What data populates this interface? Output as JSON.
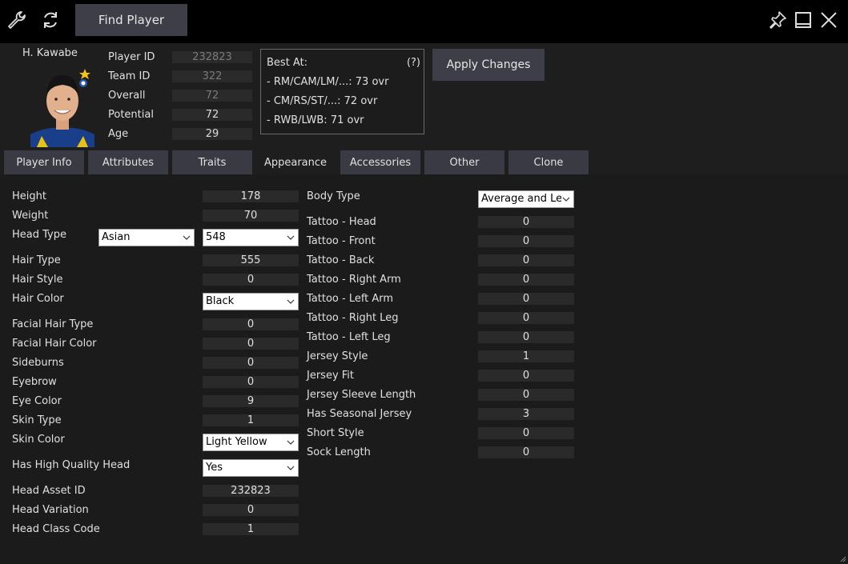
{
  "toolbar": {
    "find_player_label": "Find Player",
    "icons": [
      "wrench-icon",
      "refresh-icon",
      "pin-icon",
      "maximize-icon",
      "close-icon"
    ]
  },
  "player": {
    "name": "H. Kawabe",
    "info": [
      {
        "label": "Player ID",
        "value": "232823"
      },
      {
        "label": "Team ID",
        "value": "322"
      },
      {
        "label": "Overall",
        "value": "72"
      },
      {
        "label": "Potential",
        "value": "72"
      },
      {
        "label": "Age",
        "value": "29"
      }
    ]
  },
  "best_at": {
    "title": "Best At:",
    "help": "(?)",
    "lines": [
      "- RM/CAM/LM/...: 73 ovr",
      "- CM/RS/ST/...: 72 ovr",
      "- RWB/LWB: 71 ovr"
    ]
  },
  "apply_label": "Apply Changes",
  "tabs": [
    "Player Info",
    "Attributes",
    "Traits",
    "Appearance",
    "Accessories",
    "Other",
    "Clone"
  ],
  "active_tab": "Appearance",
  "left_fields": {
    "height": {
      "label": "Height",
      "value": "178"
    },
    "weight": {
      "label": "Weight",
      "value": "70"
    },
    "head_type": {
      "label": "Head Type",
      "select1": "Asian",
      "select2": "548"
    },
    "hair_type": {
      "label": "Hair Type",
      "value": "555"
    },
    "hair_style": {
      "label": "Hair Style",
      "value": "0"
    },
    "hair_color": {
      "label": "Hair Color",
      "select": "Black"
    },
    "facial_hair_type": {
      "label": "Facial Hair Type",
      "value": "0"
    },
    "facial_hair_color": {
      "label": "Facial Hair Color",
      "value": "0"
    },
    "sideburns": {
      "label": "Sideburns",
      "value": "0"
    },
    "eyebrow": {
      "label": "Eyebrow",
      "value": "0"
    },
    "eye_color": {
      "label": "Eye Color",
      "value": "9"
    },
    "skin_type": {
      "label": "Skin Type",
      "value": "1"
    },
    "skin_color": {
      "label": "Skin Color",
      "select": "Light Yellow"
    },
    "hq_head": {
      "label": "Has High Quality Head",
      "select": "Yes"
    },
    "head_asset_id": {
      "label": "Head Asset ID",
      "value": "232823"
    },
    "head_variation": {
      "label": "Head Variation",
      "value": "0"
    },
    "head_class_code": {
      "label": "Head Class Code",
      "value": "1"
    }
  },
  "right_fields": {
    "body_type": {
      "label": "Body Type",
      "select": "Average and Le"
    },
    "tattoo_head": {
      "label": "Tattoo - Head",
      "value": "0"
    },
    "tattoo_front": {
      "label": "Tattoo - Front",
      "value": "0"
    },
    "tattoo_back": {
      "label": "Tattoo - Back",
      "value": "0"
    },
    "tattoo_right_arm": {
      "label": "Tattoo - Right Arm",
      "value": "0"
    },
    "tattoo_left_arm": {
      "label": "Tattoo - Left Arm",
      "value": "0"
    },
    "tattoo_right_leg": {
      "label": "Tattoo - Right Leg",
      "value": "0"
    },
    "tattoo_left_leg": {
      "label": "Tattoo - Left Leg",
      "value": "0"
    },
    "jersey_style": {
      "label": "Jersey Style",
      "value": "1"
    },
    "jersey_fit": {
      "label": "Jersey Fit",
      "value": "0"
    },
    "jersey_sleeve": {
      "label": "Jersey Sleeve Length",
      "value": "0"
    },
    "seasonal_jersey": {
      "label": "Has Seasonal Jersey",
      "value": "3"
    },
    "short_style": {
      "label": "Short Style",
      "value": "0"
    },
    "sock_length": {
      "label": "Sock Length",
      "value": "0"
    }
  }
}
